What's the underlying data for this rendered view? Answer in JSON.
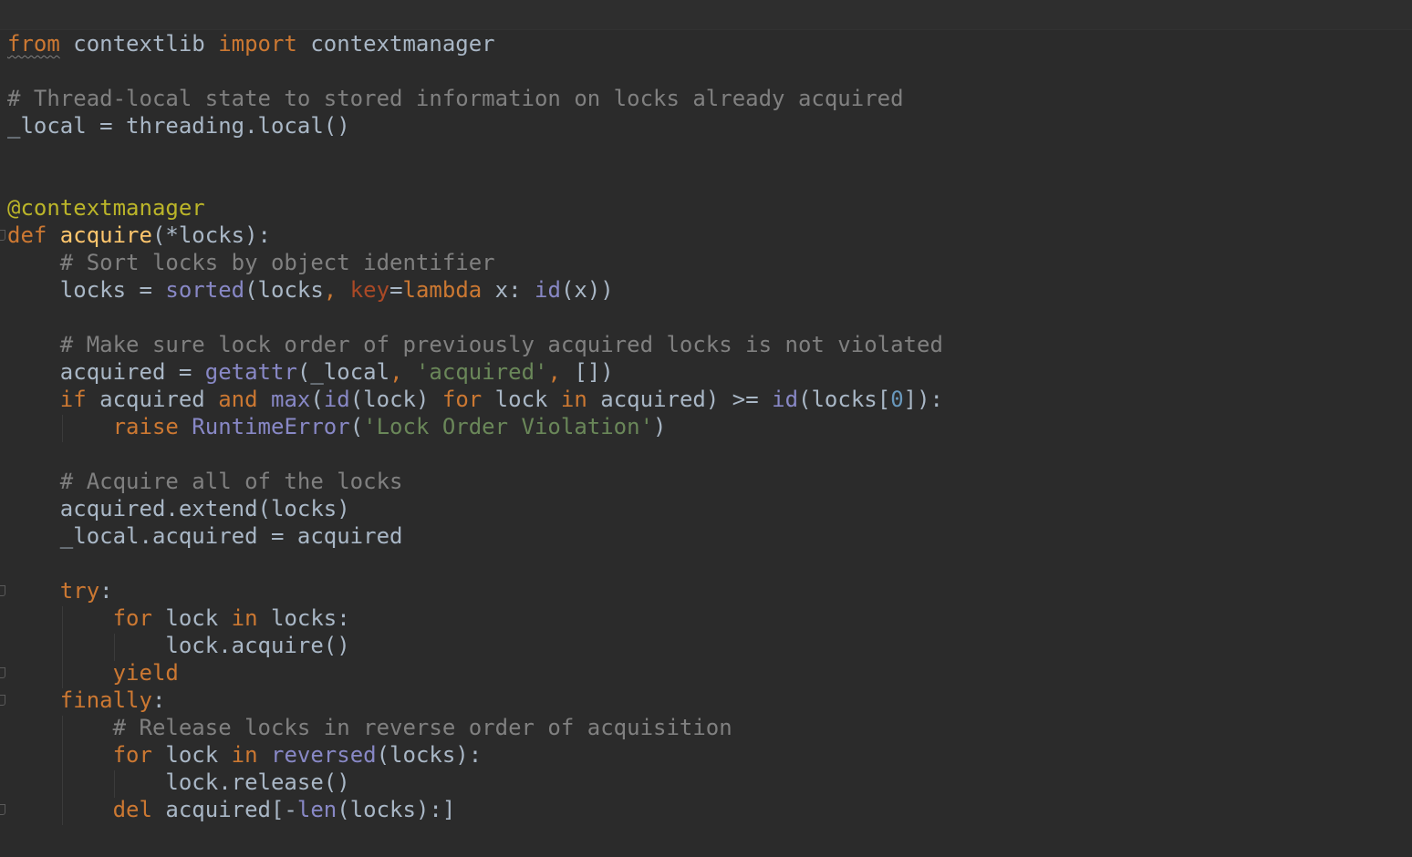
{
  "editor": {
    "language": "python",
    "theme_colors": {
      "background": "#2b2b2b",
      "default_text": "#a9b7c6",
      "keyword": "#cc7832",
      "function_def": "#ffc66d",
      "decorator": "#bbb529",
      "builtin": "#8888c6",
      "string": "#6a8759",
      "comment": "#808080",
      "number": "#6897bb",
      "param_keyword": "#aa4926"
    },
    "lines": [
      [
        [
          "k",
          "from"
        ],
        [
          "p",
          " contextlib "
        ],
        [
          "k",
          "import"
        ],
        [
          "p",
          " contextmanager"
        ]
      ],
      [],
      [
        [
          "c",
          "# Thread-local state to stored information on locks already acquired"
        ]
      ],
      [
        [
          "p",
          "_local = threading.local()"
        ]
      ],
      [],
      [],
      [
        [
          "d",
          "@contextmanager"
        ]
      ],
      [
        [
          "k",
          "def "
        ],
        [
          "f",
          "acquire"
        ],
        [
          "p",
          "(*locks):"
        ]
      ],
      [
        [
          "p",
          "    "
        ],
        [
          "c",
          "# Sort locks by object identifier"
        ]
      ],
      [
        [
          "p",
          "    locks = "
        ],
        [
          "b",
          "sorted"
        ],
        [
          "p",
          "(locks"
        ],
        [
          "k",
          ", "
        ],
        [
          "pm",
          "key"
        ],
        [
          "p",
          "="
        ],
        [
          "k",
          "lambda "
        ],
        [
          "p",
          "x: "
        ],
        [
          "b",
          "id"
        ],
        [
          "p",
          "(x))"
        ]
      ],
      [],
      [
        [
          "p",
          "    "
        ],
        [
          "c",
          "# Make sure lock order of previously acquired locks is not violated"
        ]
      ],
      [
        [
          "p",
          "    acquired = "
        ],
        [
          "b",
          "getattr"
        ],
        [
          "p",
          "(_local"
        ],
        [
          "k",
          ", "
        ],
        [
          "s",
          "'acquired'"
        ],
        [
          "k",
          ", "
        ],
        [
          "p",
          "[])"
        ]
      ],
      [
        [
          "p",
          "    "
        ],
        [
          "k",
          "if "
        ],
        [
          "p",
          "acquired "
        ],
        [
          "k",
          "and "
        ],
        [
          "b",
          "max"
        ],
        [
          "p",
          "("
        ],
        [
          "b",
          "id"
        ],
        [
          "p",
          "(lock) "
        ],
        [
          "k",
          "for "
        ],
        [
          "p",
          "lock "
        ],
        [
          "k",
          "in "
        ],
        [
          "p",
          "acquired) >= "
        ],
        [
          "b",
          "id"
        ],
        [
          "p",
          "(locks["
        ],
        [
          "n",
          "0"
        ],
        [
          "p",
          "]):"
        ]
      ],
      [
        [
          "p",
          "        "
        ],
        [
          "k",
          "raise "
        ],
        [
          "b",
          "RuntimeError"
        ],
        [
          "p",
          "("
        ],
        [
          "s",
          "'Lock Order Violation'"
        ],
        [
          "p",
          ")"
        ]
      ],
      [],
      [
        [
          "p",
          "    "
        ],
        [
          "c",
          "# Acquire all of the locks"
        ]
      ],
      [
        [
          "p",
          "    acquired.extend(locks)"
        ]
      ],
      [
        [
          "p",
          "    _local.acquired = acquired"
        ]
      ],
      [],
      [
        [
          "p",
          "    "
        ],
        [
          "k",
          "try"
        ],
        [
          "p",
          ":"
        ]
      ],
      [
        [
          "p",
          "        "
        ],
        [
          "k",
          "for "
        ],
        [
          "p",
          "lock "
        ],
        [
          "k",
          "in "
        ],
        [
          "p",
          "locks:"
        ]
      ],
      [
        [
          "p",
          "            lock.acquire()"
        ]
      ],
      [
        [
          "p",
          "        "
        ],
        [
          "k",
          "yield"
        ]
      ],
      [
        [
          "p",
          "    "
        ],
        [
          "k",
          "finally"
        ],
        [
          "p",
          ":"
        ]
      ],
      [
        [
          "p",
          "        "
        ],
        [
          "c",
          "# Release locks in reverse order of acquisition"
        ]
      ],
      [
        [
          "p",
          "        "
        ],
        [
          "k",
          "for "
        ],
        [
          "p",
          "lock "
        ],
        [
          "k",
          "in "
        ],
        [
          "b",
          "reversed"
        ],
        [
          "p",
          "(locks):"
        ]
      ],
      [
        [
          "p",
          "            lock.release()"
        ]
      ],
      [
        [
          "p",
          "        "
        ],
        [
          "k",
          "del "
        ],
        [
          "p",
          "acquired[-"
        ],
        [
          "b",
          "len"
        ],
        [
          "p",
          "(locks):]"
        ]
      ]
    ]
  }
}
